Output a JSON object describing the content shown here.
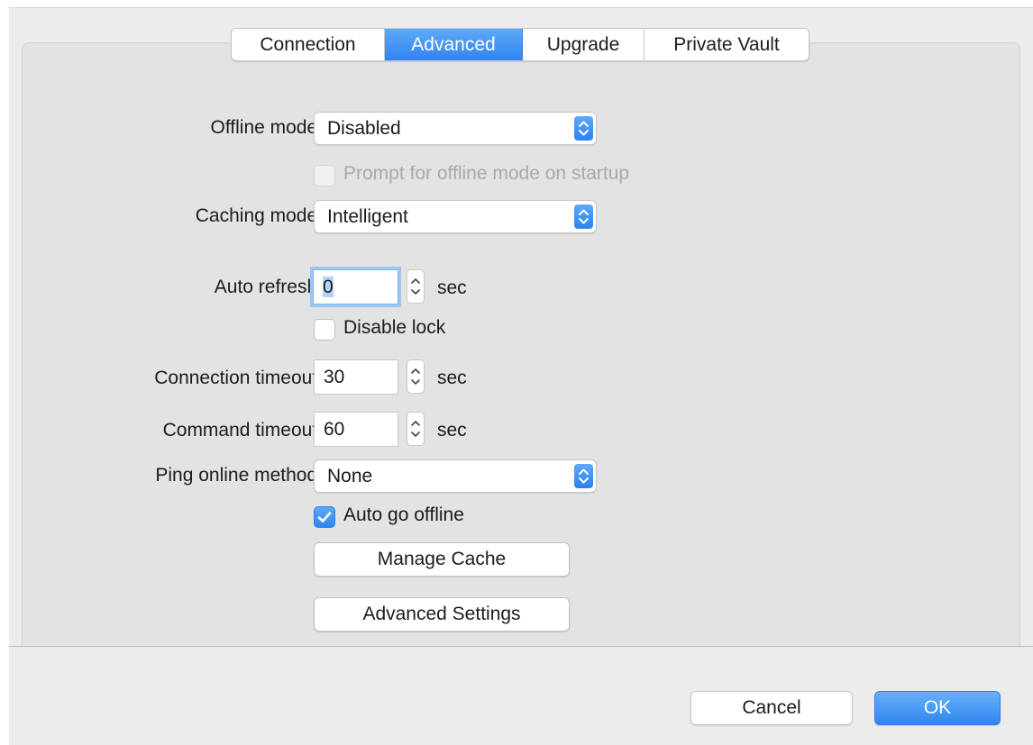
{
  "tabs": [
    {
      "label": "Connection",
      "active": false
    },
    {
      "label": "Advanced",
      "active": true
    },
    {
      "label": "Upgrade",
      "active": false
    },
    {
      "label": "Private Vault",
      "active": false
    }
  ],
  "offline_mode": {
    "label": "Offline mode:",
    "value": "Disabled"
  },
  "prompt_offline": {
    "label": "Prompt for offline mode on startup",
    "checked": false,
    "enabled": false
  },
  "caching_mode": {
    "label": "Caching mode:",
    "value": "Intelligent"
  },
  "auto_refresh": {
    "label": "Auto refresh:",
    "value": "0",
    "unit": "sec"
  },
  "disable_lock": {
    "label": "Disable lock",
    "checked": false
  },
  "connection_timeout": {
    "label": "Connection timeout:",
    "value": "30",
    "unit": "sec"
  },
  "command_timeout": {
    "label": "Command timeout:",
    "value": "60",
    "unit": "sec"
  },
  "ping_method": {
    "label": "Ping online method:",
    "value": "None"
  },
  "auto_go_offline": {
    "label": "Auto go offline",
    "checked": true
  },
  "buttons": {
    "manage_cache": "Manage Cache",
    "advanced_settings": "Advanced Settings",
    "cancel": "Cancel",
    "ok": "OK"
  },
  "colors": {
    "accent": "#2f86f0",
    "panel": "#e3e3e3",
    "window": "#ececec"
  }
}
